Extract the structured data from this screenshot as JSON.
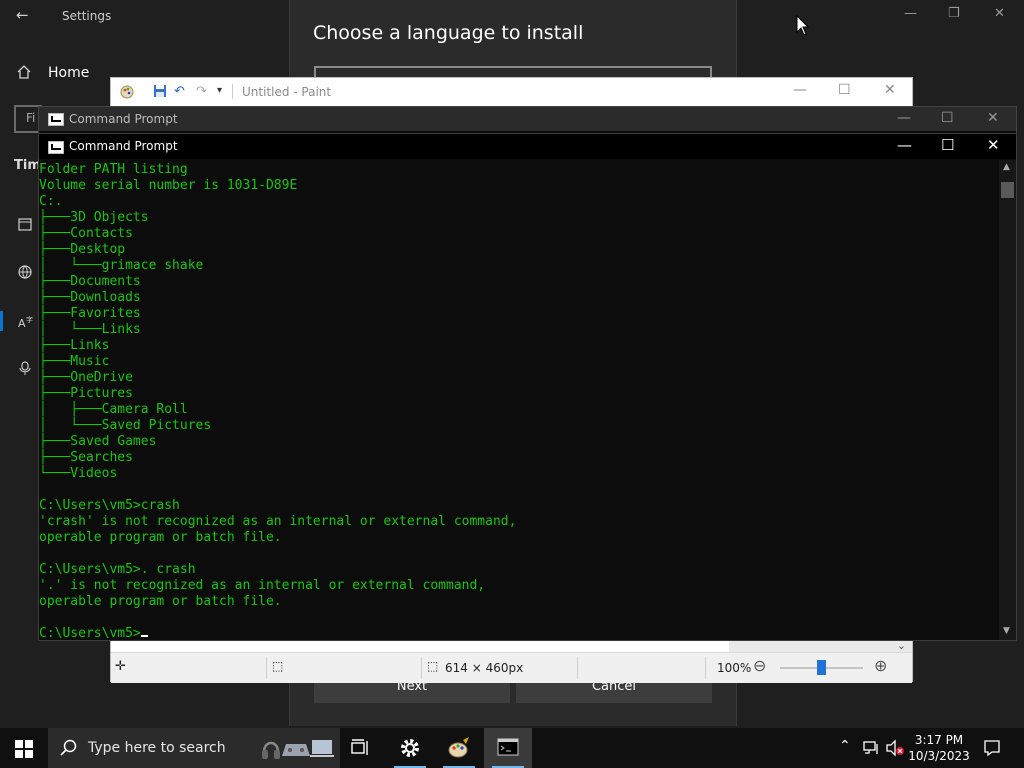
{
  "settings": {
    "title": "Settings",
    "home_label": "Home",
    "find_placeholder": "Fi",
    "section_partial": "Tim"
  },
  "language_dialog": {
    "title": "Choose a language to install",
    "next_label": "Next",
    "cancel_label": "Cancel"
  },
  "paint": {
    "title": "Untitled - Paint",
    "status": {
      "dimensions": "614 × 460px",
      "zoom": "100%"
    }
  },
  "cmd_back": {
    "title": "Command Prompt"
  },
  "cmd": {
    "title": "Command Prompt",
    "lines": [
      "Folder PATH listing",
      "Volume serial number is 1031-D89E",
      "C:.",
      "├───3D Objects",
      "├───Contacts",
      "├───Desktop",
      "│   └───grimace shake",
      "├───Documents",
      "├───Downloads",
      "├───Favorites",
      "│   └───Links",
      "├───Links",
      "├───Music",
      "├───OneDrive",
      "├───Pictures",
      "│   ├───Camera Roll",
      "│   └───Saved Pictures",
      "├───Saved Games",
      "├───Searches",
      "└───Videos",
      "",
      "C:\\Users\\vm5>crash",
      "'crash' is not recognized as an internal or external command,",
      "operable program or batch file.",
      "",
      "C:\\Users\\vm5>. crash",
      "'.' is not recognized as an internal or external command,",
      "operable program or batch file.",
      ""
    ],
    "prompt": "C:\\Users\\vm5>"
  },
  "taskbar": {
    "search_placeholder": "Type here to search",
    "time": "3:17 PM",
    "date": "10/3/2023"
  },
  "colors": {
    "console_text": "#16c60c",
    "accent": "#0a74d1",
    "taskbar_bg": "#101010"
  }
}
